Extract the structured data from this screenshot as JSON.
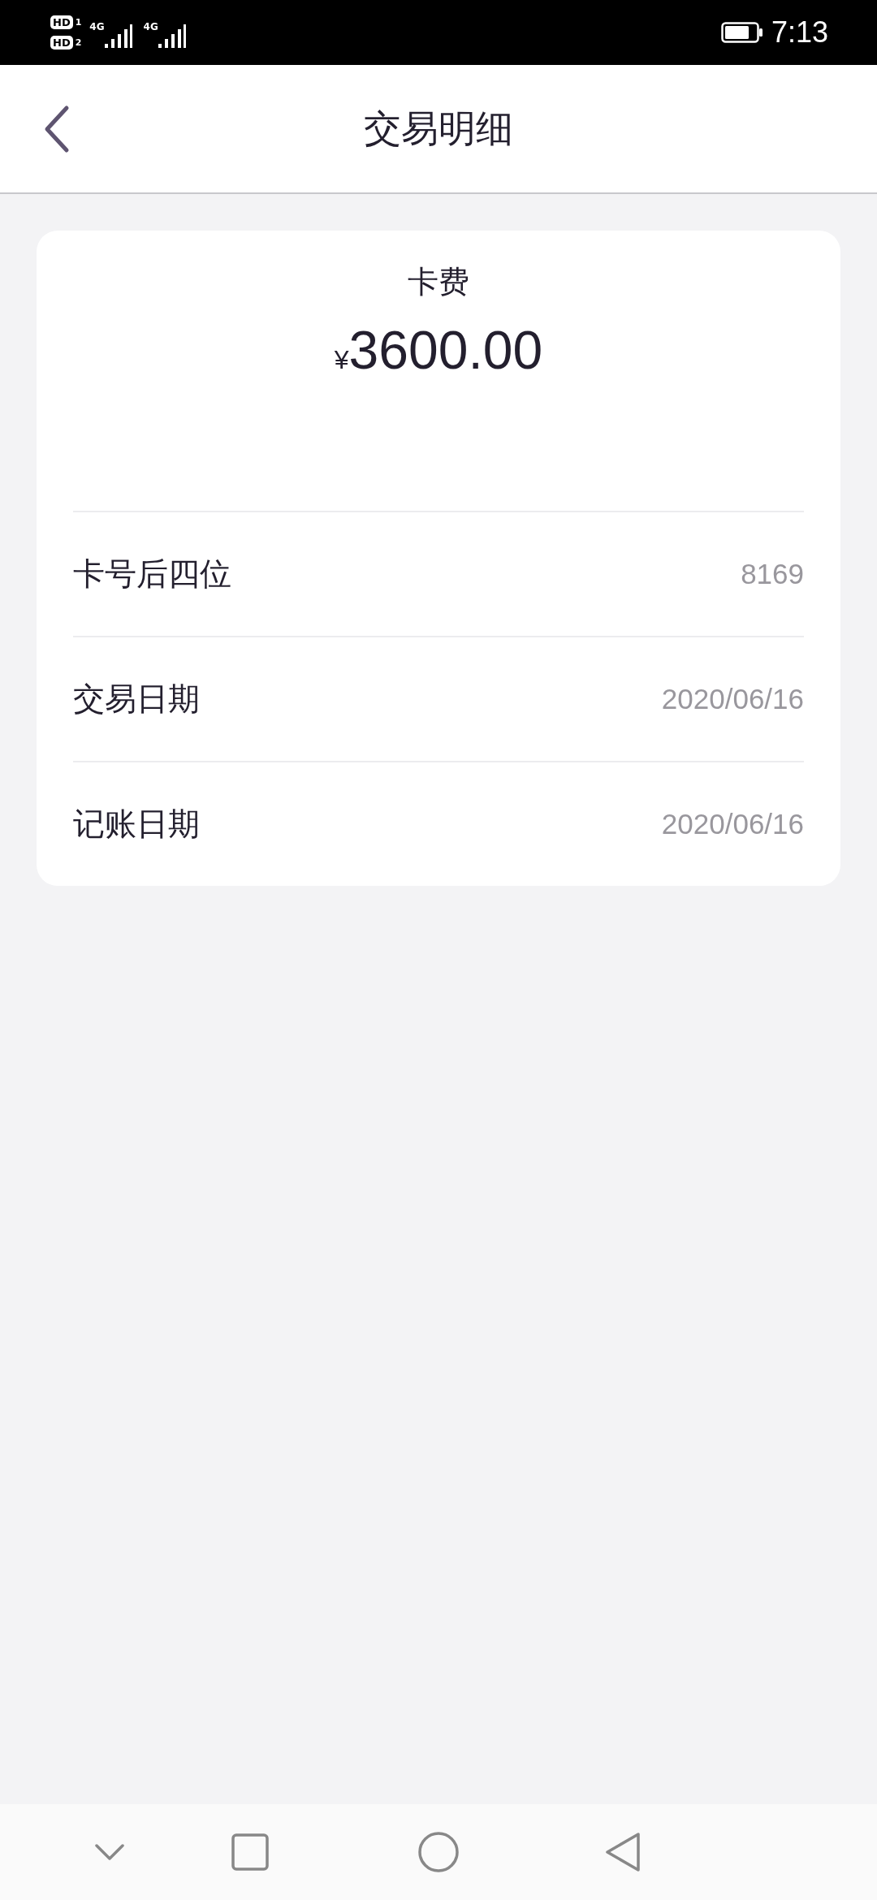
{
  "status_bar": {
    "sims": [
      {
        "hd": "HD",
        "slot": "1",
        "network": "4G"
      },
      {
        "hd": "HD",
        "slot": "2",
        "network": "4G"
      }
    ],
    "time": "7:13"
  },
  "header": {
    "title": "交易明细"
  },
  "summary": {
    "label": "卡费",
    "currency": "¥",
    "amount": "3600.00"
  },
  "details": [
    {
      "label": "卡号后四位",
      "value": "8169"
    },
    {
      "label": "交易日期",
      "value": "2020/06/16"
    },
    {
      "label": "记账日期",
      "value": "2020/06/16"
    }
  ]
}
